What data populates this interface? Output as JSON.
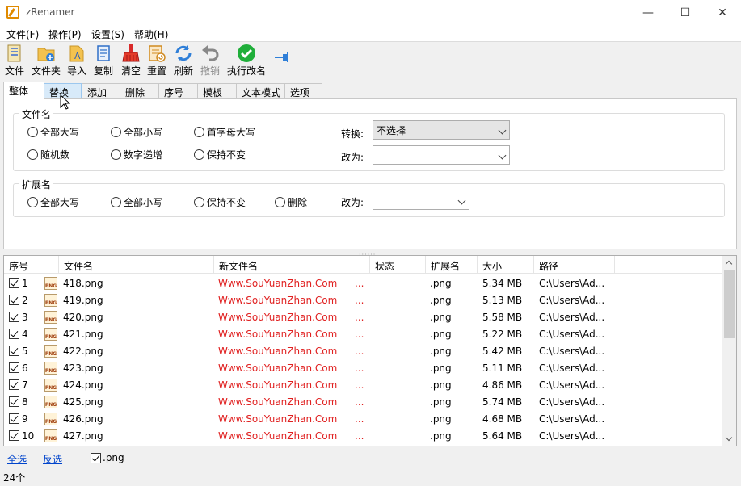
{
  "window": {
    "title": "zRenamer",
    "minimize": "—",
    "maximize": "☐",
    "close": "✕"
  },
  "menu": [
    "文件(F)",
    "操作(P)",
    "设置(S)",
    "帮助(H)"
  ],
  "toolbar": [
    {
      "icon": "file-icon",
      "label": "文件",
      "enabled": true
    },
    {
      "icon": "folder-add-icon",
      "label": "文件夹",
      "enabled": true
    },
    {
      "icon": "import-icon",
      "label": "导入",
      "enabled": true
    },
    {
      "icon": "copy-icon",
      "label": "复制",
      "enabled": true
    },
    {
      "icon": "broom-icon",
      "label": "清空",
      "enabled": true
    },
    {
      "icon": "reset-icon",
      "label": "重置",
      "enabled": true
    },
    {
      "icon": "refresh-icon",
      "label": "刷新",
      "enabled": true
    },
    {
      "icon": "undo-icon",
      "label": "撤销",
      "enabled": false
    },
    {
      "icon": "check-circle-icon",
      "label": "执行改名",
      "enabled": true
    }
  ],
  "tabs": [
    "整体",
    "替换",
    "添加",
    "删除",
    "序号",
    "模板",
    "文本模式",
    "选项"
  ],
  "active_tab": "整体",
  "hover_tab": "替换",
  "filename_group": {
    "title": "文件名",
    "options_row1": [
      "全部大写",
      "全部小写",
      "首字母大写"
    ],
    "options_row2": [
      "随机数",
      "数字递增",
      "保持不变"
    ],
    "convert_label": "转换:",
    "convert_value": "不选择",
    "change_label": "改为:",
    "change_value": ""
  },
  "ext_group": {
    "title": "扩展名",
    "options": [
      "全部大写",
      "全部小写",
      "保持不变",
      "删除"
    ],
    "change_label": "改为:",
    "change_value": ""
  },
  "columns": [
    "序号",
    "",
    "文件名",
    "新文件名",
    "状态",
    "扩展名",
    "大小",
    "路径"
  ],
  "rows": [
    {
      "index": "1",
      "name": "418.png",
      "new": "Www.SouYuanZhan.Com",
      "ext": ".png",
      "size": "5.34 MB",
      "path": "C:\\Users\\Ad..."
    },
    {
      "index": "2",
      "name": "419.png",
      "new": "Www.SouYuanZhan.Com",
      "ext": ".png",
      "size": "5.13 MB",
      "path": "C:\\Users\\Ad..."
    },
    {
      "index": "3",
      "name": "420.png",
      "new": "Www.SouYuanZhan.Com",
      "ext": ".png",
      "size": "5.58 MB",
      "path": "C:\\Users\\Ad..."
    },
    {
      "index": "4",
      "name": "421.png",
      "new": "Www.SouYuanZhan.Com",
      "ext": ".png",
      "size": "5.22 MB",
      "path": "C:\\Users\\Ad..."
    },
    {
      "index": "5",
      "name": "422.png",
      "new": "Www.SouYuanZhan.Com",
      "ext": ".png",
      "size": "5.42 MB",
      "path": "C:\\Users\\Ad..."
    },
    {
      "index": "6",
      "name": "423.png",
      "new": "Www.SouYuanZhan.Com",
      "ext": ".png",
      "size": "5.11 MB",
      "path": "C:\\Users\\Ad..."
    },
    {
      "index": "7",
      "name": "424.png",
      "new": "Www.SouYuanZhan.Com",
      "ext": ".png",
      "size": "4.86 MB",
      "path": "C:\\Users\\Ad..."
    },
    {
      "index": "8",
      "name": "425.png",
      "new": "Www.SouYuanZhan.Com",
      "ext": ".png",
      "size": "5.74 MB",
      "path": "C:\\Users\\Ad..."
    },
    {
      "index": "9",
      "name": "426.png",
      "new": "Www.SouYuanZhan.Com",
      "ext": ".png",
      "size": "4.68 MB",
      "path": "C:\\Users\\Ad..."
    },
    {
      "index": "10",
      "name": "427.png",
      "new": "Www.SouYuanZhan.Com",
      "ext": ".png",
      "size": "5.64 MB",
      "path": "C:\\Users\\Ad..."
    }
  ],
  "new_name_suffix": "...",
  "file_badge": "PNG",
  "bottom": {
    "select_all": "全选",
    "invert": "反选",
    "filter_ext": ".png"
  },
  "status": "24个",
  "colors": {
    "new_name": "#e02020",
    "link": "#0044cc",
    "tab_hover": "#d8eaf9"
  }
}
